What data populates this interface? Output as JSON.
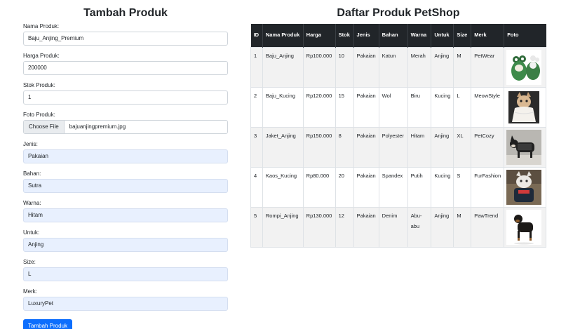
{
  "form": {
    "title": "Tambah Produk",
    "fields": [
      {
        "label": "Nama Produk:",
        "value": "Baju_Anjing_Premium"
      },
      {
        "label": "Harga Produk:",
        "value": "200000"
      },
      {
        "label": "Stok Produk:",
        "value": "1"
      }
    ],
    "file": {
      "label": "Foto Produk:",
      "button": "Choose File",
      "filename": "bajuanjingpremium.jpg"
    },
    "attributes": [
      {
        "label": "Jenis:",
        "value": "Pakaian"
      },
      {
        "label": "Bahan:",
        "value": "Sutra"
      },
      {
        "label": "Warna:",
        "value": "Hitam"
      },
      {
        "label": "Untuk:",
        "value": "Anjing"
      },
      {
        "label": "Size:",
        "value": "L"
      },
      {
        "label": "Merk:",
        "value": "LuxuryPet"
      }
    ],
    "submit_label": "Tambah Produk"
  },
  "table": {
    "title": "Daftar Produk PetShop",
    "headers": {
      "id": "ID",
      "nama": "Nama Produk",
      "harga": "Harga",
      "stok": "Stok",
      "jenis": "Jenis",
      "bahan": "Bahan",
      "warna": "Warna",
      "untuk": "Untuk",
      "size": "Size",
      "merk": "Merk",
      "foto": "Foto"
    },
    "rows": [
      {
        "id": "1",
        "nama": "Baju_Anjing",
        "harga": "Rp100.000",
        "stok": "10",
        "jenis": "Pakaian",
        "bahan": "Katun",
        "warna": "Merah",
        "untuk": "Anjing",
        "size": "M",
        "merk": "PetWear",
        "photo_icon": "green-frog-dog-costume"
      },
      {
        "id": "2",
        "nama": "Baju_Kucing",
        "harga": "Rp120.000",
        "stok": "15",
        "jenis": "Pakaian",
        "bahan": "Wol",
        "warna": "Biru",
        "untuk": "Kucing",
        "size": "L",
        "merk": "MeowStyle",
        "photo_icon": "cat-in-dress"
      },
      {
        "id": "3",
        "nama": "Jaket_Anjing",
        "harga": "Rp150.000",
        "stok": "8",
        "jenis": "Pakaian",
        "bahan": "Polyester",
        "warna": "Hitam",
        "untuk": "Anjing",
        "size": "XL",
        "merk": "PetCozy",
        "photo_icon": "dog-in-jacket"
      },
      {
        "id": "4",
        "nama": "Kaos_Kucing",
        "harga": "Rp80.000",
        "stok": "20",
        "jenis": "Pakaian",
        "bahan": "Spandex",
        "warna": "Putih",
        "untuk": "Kucing",
        "size": "S",
        "merk": "FurFashion",
        "photo_icon": "cat-in-shirt"
      },
      {
        "id": "5",
        "nama": "Rompi_Anjing",
        "harga": "Rp130.000",
        "stok": "12",
        "jenis": "Pakaian",
        "bahan": "Denim",
        "warna": "Abu-abu",
        "untuk": "Anjing",
        "size": "M",
        "merk": "PawTrend",
        "photo_icon": "rottweiler-in-vest"
      }
    ]
  },
  "colors": {
    "primary": "#0d6efd",
    "table_header": "#212529",
    "autofill": "#e8f0fe"
  }
}
